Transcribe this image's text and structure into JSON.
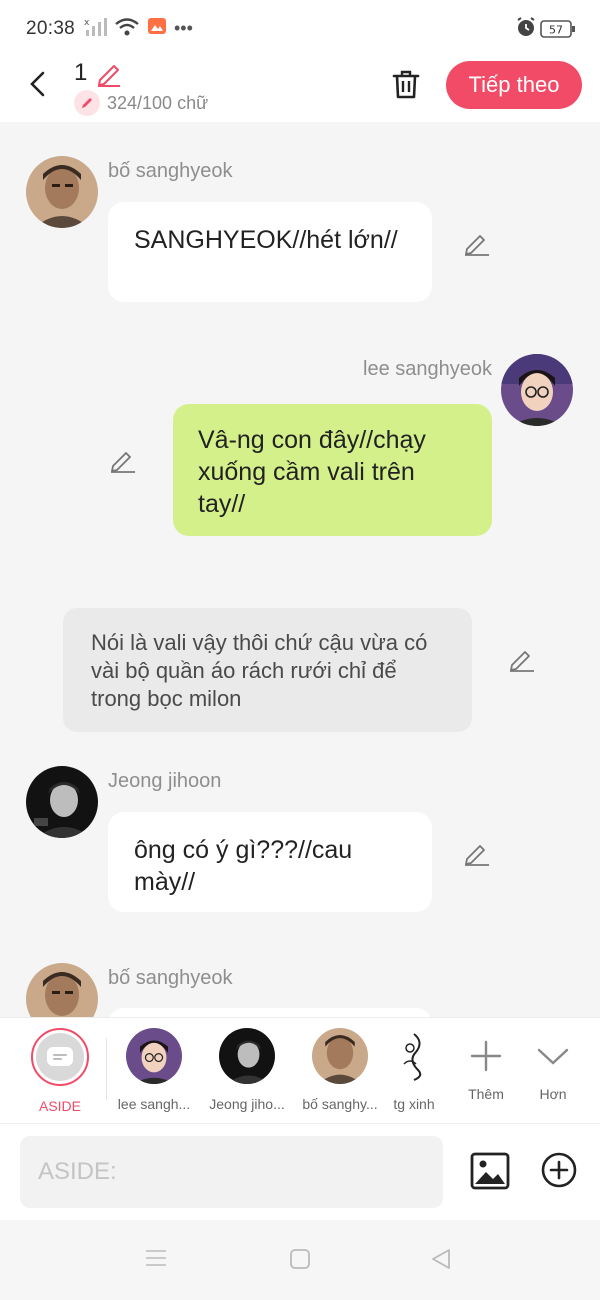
{
  "status_bar": {
    "time": "20:38",
    "battery": "57",
    "icons": [
      "no-signal-icon",
      "wifi-icon",
      "gallery-notification-icon",
      "more-dots-icon",
      "alarm-icon",
      "battery-icon"
    ]
  },
  "header": {
    "chapter_number": "1",
    "word_count": "324/100 chữ",
    "next_label": "Tiếp theo",
    "accent_color": "#f24b67"
  },
  "messages": [
    {
      "type": "left",
      "sender": "bố sanghyeok",
      "text": "SANGHYEOK//hét lớn//"
    },
    {
      "type": "right",
      "sender": "lee sanghyeok",
      "text": "Vâ-ng con đây//chạy xuống cầm vali trên tay//"
    },
    {
      "type": "aside",
      "text": "Nói là vali vậy thôi chứ cậu vừa có vài bộ quần áo rách rưới chỉ để trong bọc milon"
    },
    {
      "type": "left",
      "sender": "Jeong jihoon",
      "text": "ông có ý gì???//cau mày//"
    },
    {
      "type": "left",
      "sender": "bố sanghyeok",
      "text": ""
    }
  ],
  "characters": {
    "aside_label": "ASIDE",
    "items": [
      {
        "name": "lee sangh..."
      },
      {
        "name": "Jeong jiho..."
      },
      {
        "name": "bố sanghy..."
      },
      {
        "name": "tg xinh"
      }
    ],
    "add_label": "Thêm",
    "more_label": "Hơn"
  },
  "input": {
    "placeholder": "ASIDE:",
    "value": ""
  }
}
